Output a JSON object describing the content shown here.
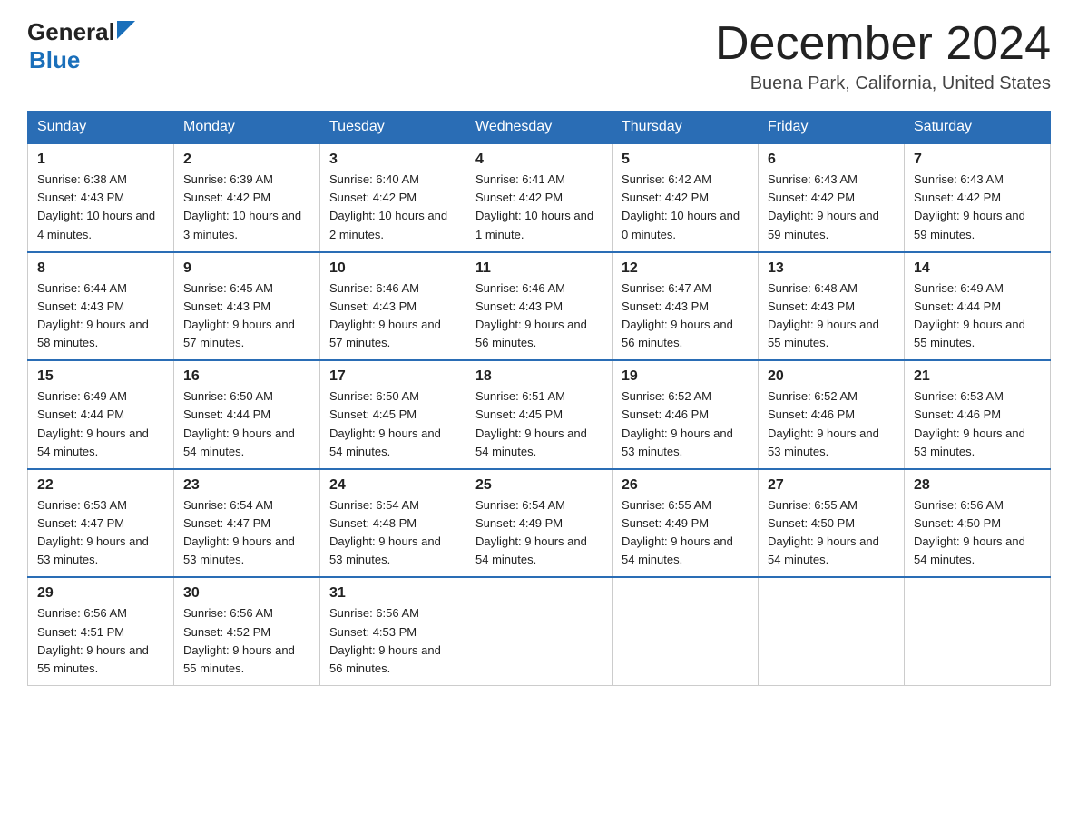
{
  "header": {
    "logo_general": "General",
    "logo_blue": "Blue",
    "month_title": "December 2024",
    "location": "Buena Park, California, United States"
  },
  "days_of_week": [
    "Sunday",
    "Monday",
    "Tuesday",
    "Wednesday",
    "Thursday",
    "Friday",
    "Saturday"
  ],
  "weeks": [
    [
      {
        "day": "1",
        "sunrise": "6:38 AM",
        "sunset": "4:43 PM",
        "daylight": "10 hours and 4 minutes."
      },
      {
        "day": "2",
        "sunrise": "6:39 AM",
        "sunset": "4:42 PM",
        "daylight": "10 hours and 3 minutes."
      },
      {
        "day": "3",
        "sunrise": "6:40 AM",
        "sunset": "4:42 PM",
        "daylight": "10 hours and 2 minutes."
      },
      {
        "day": "4",
        "sunrise": "6:41 AM",
        "sunset": "4:42 PM",
        "daylight": "10 hours and 1 minute."
      },
      {
        "day": "5",
        "sunrise": "6:42 AM",
        "sunset": "4:42 PM",
        "daylight": "10 hours and 0 minutes."
      },
      {
        "day": "6",
        "sunrise": "6:43 AM",
        "sunset": "4:42 PM",
        "daylight": "9 hours and 59 minutes."
      },
      {
        "day": "7",
        "sunrise": "6:43 AM",
        "sunset": "4:42 PM",
        "daylight": "9 hours and 59 minutes."
      }
    ],
    [
      {
        "day": "8",
        "sunrise": "6:44 AM",
        "sunset": "4:43 PM",
        "daylight": "9 hours and 58 minutes."
      },
      {
        "day": "9",
        "sunrise": "6:45 AM",
        "sunset": "4:43 PM",
        "daylight": "9 hours and 57 minutes."
      },
      {
        "day": "10",
        "sunrise": "6:46 AM",
        "sunset": "4:43 PM",
        "daylight": "9 hours and 57 minutes."
      },
      {
        "day": "11",
        "sunrise": "6:46 AM",
        "sunset": "4:43 PM",
        "daylight": "9 hours and 56 minutes."
      },
      {
        "day": "12",
        "sunrise": "6:47 AM",
        "sunset": "4:43 PM",
        "daylight": "9 hours and 56 minutes."
      },
      {
        "day": "13",
        "sunrise": "6:48 AM",
        "sunset": "4:43 PM",
        "daylight": "9 hours and 55 minutes."
      },
      {
        "day": "14",
        "sunrise": "6:49 AM",
        "sunset": "4:44 PM",
        "daylight": "9 hours and 55 minutes."
      }
    ],
    [
      {
        "day": "15",
        "sunrise": "6:49 AM",
        "sunset": "4:44 PM",
        "daylight": "9 hours and 54 minutes."
      },
      {
        "day": "16",
        "sunrise": "6:50 AM",
        "sunset": "4:44 PM",
        "daylight": "9 hours and 54 minutes."
      },
      {
        "day": "17",
        "sunrise": "6:50 AM",
        "sunset": "4:45 PM",
        "daylight": "9 hours and 54 minutes."
      },
      {
        "day": "18",
        "sunrise": "6:51 AM",
        "sunset": "4:45 PM",
        "daylight": "9 hours and 54 minutes."
      },
      {
        "day": "19",
        "sunrise": "6:52 AM",
        "sunset": "4:46 PM",
        "daylight": "9 hours and 53 minutes."
      },
      {
        "day": "20",
        "sunrise": "6:52 AM",
        "sunset": "4:46 PM",
        "daylight": "9 hours and 53 minutes."
      },
      {
        "day": "21",
        "sunrise": "6:53 AM",
        "sunset": "4:46 PM",
        "daylight": "9 hours and 53 minutes."
      }
    ],
    [
      {
        "day": "22",
        "sunrise": "6:53 AM",
        "sunset": "4:47 PM",
        "daylight": "9 hours and 53 minutes."
      },
      {
        "day": "23",
        "sunrise": "6:54 AM",
        "sunset": "4:47 PM",
        "daylight": "9 hours and 53 minutes."
      },
      {
        "day": "24",
        "sunrise": "6:54 AM",
        "sunset": "4:48 PM",
        "daylight": "9 hours and 53 minutes."
      },
      {
        "day": "25",
        "sunrise": "6:54 AM",
        "sunset": "4:49 PM",
        "daylight": "9 hours and 54 minutes."
      },
      {
        "day": "26",
        "sunrise": "6:55 AM",
        "sunset": "4:49 PM",
        "daylight": "9 hours and 54 minutes."
      },
      {
        "day": "27",
        "sunrise": "6:55 AM",
        "sunset": "4:50 PM",
        "daylight": "9 hours and 54 minutes."
      },
      {
        "day": "28",
        "sunrise": "6:56 AM",
        "sunset": "4:50 PM",
        "daylight": "9 hours and 54 minutes."
      }
    ],
    [
      {
        "day": "29",
        "sunrise": "6:56 AM",
        "sunset": "4:51 PM",
        "daylight": "9 hours and 55 minutes."
      },
      {
        "day": "30",
        "sunrise": "6:56 AM",
        "sunset": "4:52 PM",
        "daylight": "9 hours and 55 minutes."
      },
      {
        "day": "31",
        "sunrise": "6:56 AM",
        "sunset": "4:53 PM",
        "daylight": "9 hours and 56 minutes."
      },
      null,
      null,
      null,
      null
    ]
  ]
}
